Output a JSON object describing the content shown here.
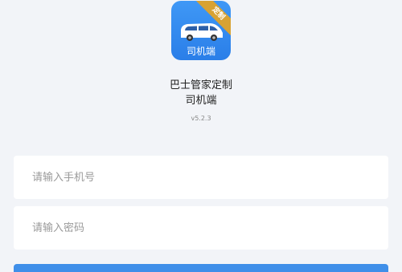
{
  "app": {
    "logo_ribbon": "定制",
    "logo_caption": "司机端",
    "name": "巴士管家定制",
    "subtitle": "司机端",
    "version": "v5.2.3"
  },
  "form": {
    "phone_placeholder": "请输入手机号",
    "password_placeholder": "请输入密码"
  },
  "colors": {
    "background": "#f2f4f8",
    "logo_blue": "#2a7ee8",
    "ribbon_gold": "#d8a233",
    "button_blue": "#3f8fe9"
  }
}
